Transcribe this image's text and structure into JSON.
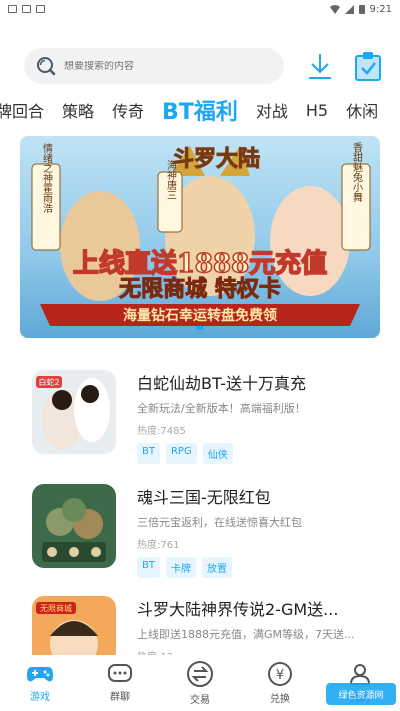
{
  "status_bar": {
    "time": "9:21"
  },
  "search": {
    "placeholder": "想要搜索的内容"
  },
  "categories": [
    "牌回合",
    "策略",
    "传奇",
    "BT福利",
    "对战",
    "H5",
    "休闲"
  ],
  "banner": {
    "title_top": "斗罗大陆",
    "headline": "上线直送1888元充值",
    "sub": "无限商城 特权卡",
    "ribbon": "海量钻石幸运转盘免费领",
    "char_labels": [
      "海神唐三",
      "香甜魅兔小舞",
      "情绪之神霍雨浩"
    ]
  },
  "games": [
    {
      "title": "白蛇仙劫BT-送十万真充",
      "desc": "全新玩法/全新版本！高端福利版！",
      "hot": "热度:7485",
      "tags": [
        "BT",
        "RPG",
        "仙侠"
      ],
      "badge": "白蛇2"
    },
    {
      "title": "魂斗三国-无限红包",
      "desc": "三倍元宝返利，在线送惊喜大红包",
      "hot": "热度:761",
      "tags": [
        "BT",
        "卡牌",
        "放置"
      ]
    },
    {
      "title": "斗罗大陆神界传说2-GM送...",
      "desc": "上线即送1888元充值，满GM等级，7天送...",
      "hot": "热度:12",
      "badge": "无限商城"
    }
  ],
  "bottom_nav": [
    {
      "label": "游戏",
      "active": true
    },
    {
      "label": "群聊"
    },
    {
      "label": "交易"
    },
    {
      "label": "兑换"
    },
    {
      "label": "我的"
    }
  ],
  "watermark": "绿色资源网",
  "colors": {
    "accent": "#1ea7f5",
    "tag_bg": "#e6f5fe"
  }
}
